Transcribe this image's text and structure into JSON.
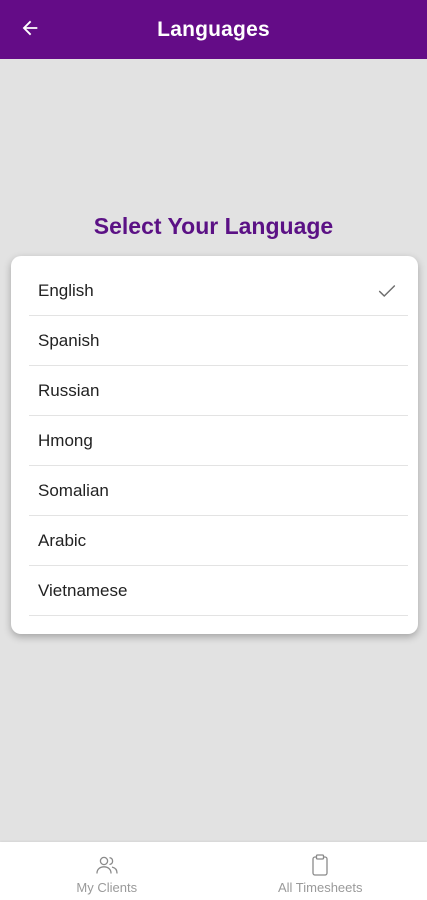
{
  "header": {
    "title": "Languages",
    "back_icon": "arrow-left-icon"
  },
  "heading": "Select Your Language",
  "languages": [
    {
      "label": "English",
      "selected": true
    },
    {
      "label": "Spanish",
      "selected": false
    },
    {
      "label": "Russian",
      "selected": false
    },
    {
      "label": "Hmong",
      "selected": false
    },
    {
      "label": "Somalian",
      "selected": false
    },
    {
      "label": "Arabic",
      "selected": false
    },
    {
      "label": "Vietnamese",
      "selected": false
    }
  ],
  "bottom_nav": [
    {
      "label": "My Clients",
      "icon": "people-icon"
    },
    {
      "label": "All Timesheets",
      "icon": "clipboard-icon"
    }
  ],
  "colors": {
    "app_bar": "#640c87",
    "heading": "#5b1185",
    "background": "#e2e2e2"
  }
}
